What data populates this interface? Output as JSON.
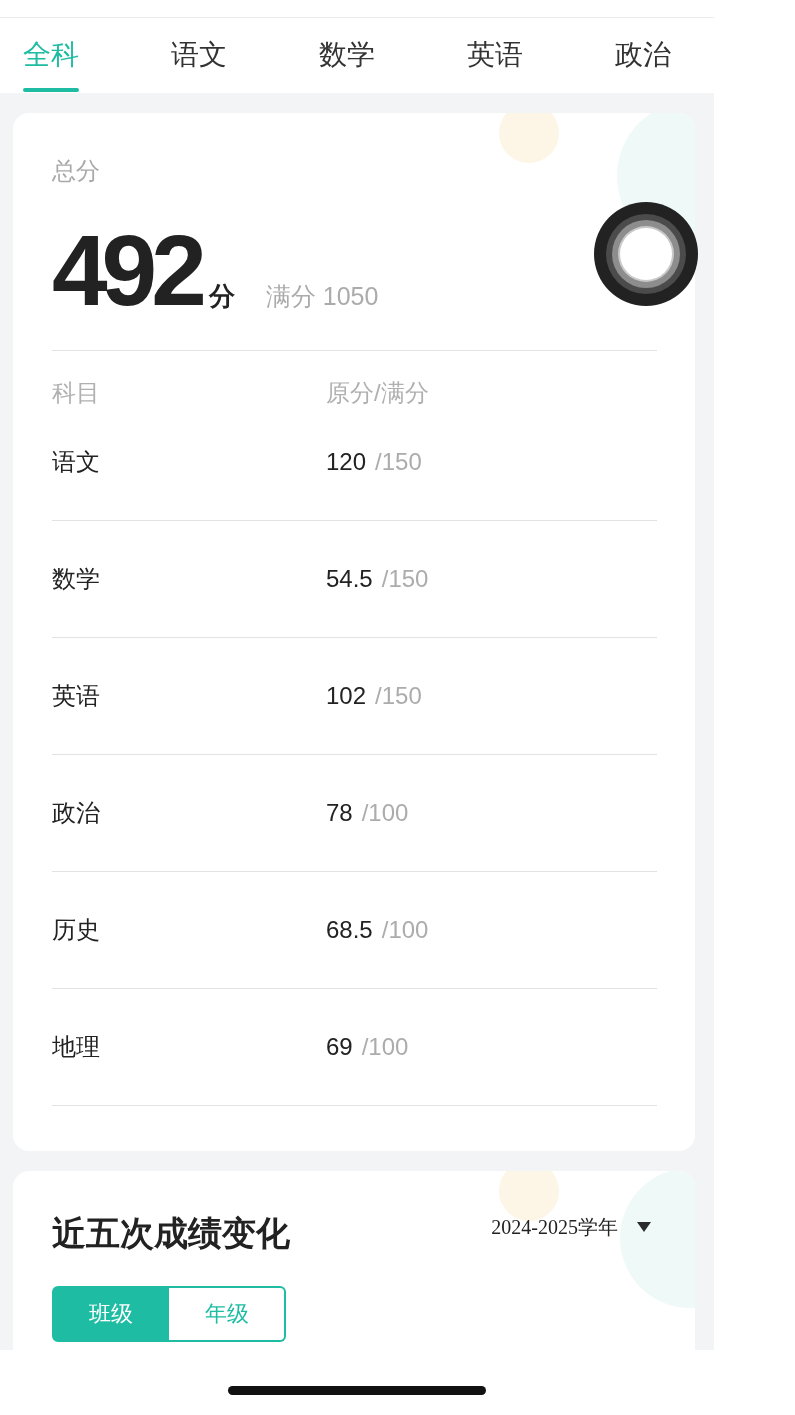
{
  "tabs": [
    {
      "label": "全科",
      "selected": true
    },
    {
      "label": "语文",
      "selected": false
    },
    {
      "label": "数学",
      "selected": false
    },
    {
      "label": "英语",
      "selected": false
    },
    {
      "label": "政治",
      "selected": false
    }
  ],
  "total": {
    "label": "总分",
    "score": "492",
    "unit": "分",
    "full_mark": "满分 1050"
  },
  "table": {
    "columns": [
      "科目",
      "原分/满分"
    ],
    "rows": [
      {
        "subject": "语文",
        "score": "120",
        "full": "/150"
      },
      {
        "subject": "数学",
        "score": "54.5",
        "full": "/150"
      },
      {
        "subject": "英语",
        "score": "102",
        "full": "/150"
      },
      {
        "subject": "政治",
        "score": "78",
        "full": "/100"
      },
      {
        "subject": "历史",
        "score": "68.5",
        "full": "/100"
      },
      {
        "subject": "地理",
        "score": "69",
        "full": "/100"
      }
    ]
  },
  "trend": {
    "title": "近五次成绩变化",
    "year": "2024-2025学年",
    "segments": [
      {
        "label": "班级",
        "selected": true
      },
      {
        "label": "年级",
        "selected": false
      }
    ]
  }
}
